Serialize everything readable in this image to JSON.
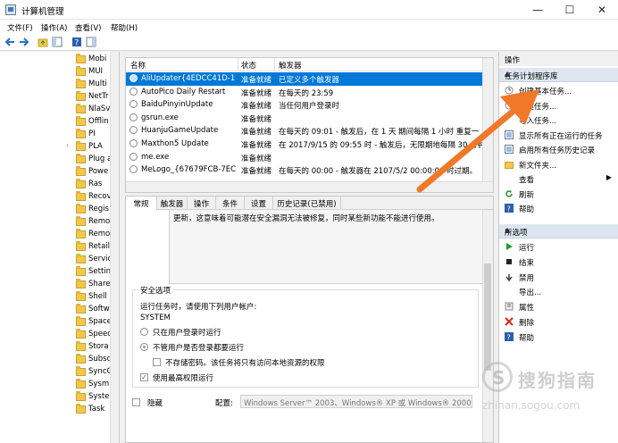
{
  "window": {
    "title": "计算机管理",
    "minimize": "—",
    "maximize": "☐",
    "close": "✕"
  },
  "menu": [
    "文件(F)",
    "操作(A)",
    "查看(V)",
    "帮助(H)"
  ],
  "tree": {
    "items": [
      {
        "label": "Mobi"
      },
      {
        "label": "MUI"
      },
      {
        "label": "Multi"
      },
      {
        "label": "NetTr"
      },
      {
        "label": "NlaSv"
      },
      {
        "label": "Offlin"
      },
      {
        "label": "PI"
      },
      {
        "label": "PLA",
        "expander": "›"
      },
      {
        "label": "Plug a"
      },
      {
        "label": "Powe"
      },
      {
        "label": "Ras"
      },
      {
        "label": "Recov"
      },
      {
        "label": "Regis"
      },
      {
        "label": "Remo"
      },
      {
        "label": "Remo"
      },
      {
        "label": "Retail"
      },
      {
        "label": "Servic"
      },
      {
        "label": "Settin"
      },
      {
        "label": "Share"
      },
      {
        "label": "Shell"
      },
      {
        "label": "Softw"
      },
      {
        "label": "Space"
      },
      {
        "label": "Speec"
      },
      {
        "label": "Stora"
      },
      {
        "label": "Subsc"
      },
      {
        "label": "SyncC"
      },
      {
        "label": "Sysm"
      },
      {
        "label": "Syste"
      },
      {
        "label": "Task"
      }
    ]
  },
  "tasklist": {
    "columns": [
      "名称",
      "状态",
      "触发器"
    ],
    "rows": [
      {
        "name": "AliUpdater{4EDCC41D-1...",
        "status": "准备就绪",
        "trigger": "已定义多个触发器",
        "selected": true
      },
      {
        "name": "AutoPico Daily Restart",
        "status": "准备就绪",
        "trigger": "在每天的 23:59"
      },
      {
        "name": "BaiduPinyinUpdate",
        "status": "准备就绪",
        "trigger": "当任何用户登录时"
      },
      {
        "name": "gsrun.exe",
        "status": "准备就绪",
        "trigger": ""
      },
      {
        "name": "HuanjuGameUpdate",
        "status": "准备就绪",
        "trigger": "在每天的 09:01 - 触发后，在 1 天 期间每隔 1 小时 重复一"
      },
      {
        "name": "Maxthon5 Update",
        "status": "准备就绪",
        "trigger": "在 2017/9/15 的 09:55 时 - 触发后，无限期地每隔 30 分钟"
      },
      {
        "name": "me.exe",
        "status": "准备就绪",
        "trigger": ""
      },
      {
        "name": "MeLogo_{67679FCB-7EC...",
        "status": "准备就绪",
        "trigger": "在每天的 00:00 - 触发器在 2107/5/2 00:00:00 时过期。"
      }
    ]
  },
  "detail": {
    "tabs": [
      "常规",
      "触发器",
      "操作",
      "条件",
      "设置",
      "历史记录(已禁用)"
    ],
    "description": "更新，这意味着可能潜在安全漏洞无法被修复，同时某些新功能不能进行使用。",
    "security_title": "安全选项",
    "run_as_label": "运行任务时，请使用下列用户帐户:",
    "user": "SYSTEM",
    "opt_logged_on": "只在用户登录时运行",
    "opt_any": "不管用户是否登录都要运行",
    "opt_no_store": "不存储密码。该任务将只有访问本地资源的权限",
    "opt_highest": "使用最高权限运行",
    "hidden_label": "隐藏",
    "config_label": "配置:",
    "config_value": "Windows Server™ 2003、Windows® XP 或 Windows® 2000"
  },
  "actions": {
    "header": "操作",
    "section1": "任务计划程序库",
    "items1": [
      {
        "label": "创建基本任务..."
      },
      {
        "label": "创建任务..."
      },
      {
        "label": "导入任务..."
      },
      {
        "label": "显示所有正在运行的任务"
      },
      {
        "label": "启用所有任务历史记录"
      },
      {
        "label": "新文件夹..."
      },
      {
        "label": "查看",
        "sub": "▶"
      },
      {
        "label": "刷新"
      },
      {
        "label": "帮助"
      }
    ],
    "section2": "所选项",
    "items2": [
      {
        "label": "运行"
      },
      {
        "label": "结束"
      },
      {
        "label": "禁用"
      },
      {
        "label": "导出..."
      },
      {
        "label": "属性"
      },
      {
        "label": "删除"
      },
      {
        "label": "帮助"
      }
    ],
    "collapse": "▲"
  },
  "watermark": {
    "brand": "搜狗指南",
    "url": "zhinan.sogou.com"
  },
  "colors": {
    "selection": "#0078d7",
    "section_bg": "#dde6f0",
    "arrow": "#f07828"
  }
}
